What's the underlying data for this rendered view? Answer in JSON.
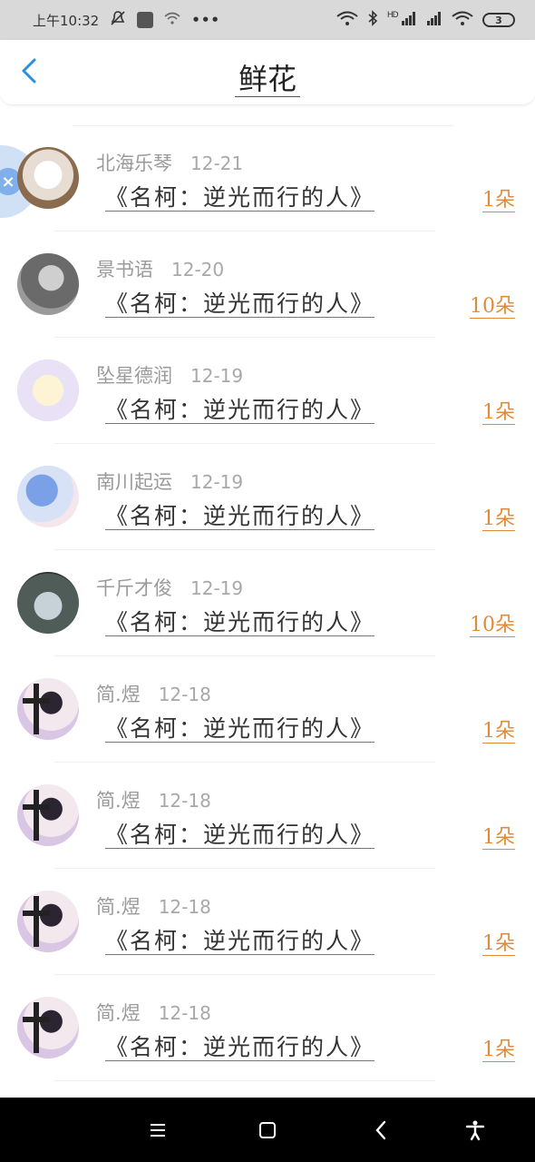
{
  "status_bar": {
    "time": "上午10:32",
    "battery": "3",
    "hd_label": "HD"
  },
  "header": {
    "title": "鲜花"
  },
  "gifts": [
    {
      "name": "北海乐琴",
      "date": "12-21",
      "gift": "《名柯：逆光而行的人》",
      "count": "1朵",
      "avatar": "cat-avatar"
    },
    {
      "name": "景书语",
      "date": "12-20",
      "gift": "《名柯：逆光而行的人》",
      "count": "10朵",
      "avatar": "bw-avatar"
    },
    {
      "name": "坠星德润",
      "date": "12-19",
      "gift": "《名柯：逆光而行的人》",
      "count": "1朵",
      "avatar": "anime-avatar"
    },
    {
      "name": "南川起运",
      "date": "12-19",
      "gift": "《名柯：逆光而行的人》",
      "count": "1朵",
      "avatar": "anime-avatar"
    },
    {
      "name": "千斤才俊",
      "date": "12-19",
      "gift": "《名柯：逆光而行的人》",
      "count": "10朵",
      "avatar": "forest-avatar"
    },
    {
      "name": "简.煜",
      "date": "12-18",
      "gift": "《名柯：逆光而行的人》",
      "count": "1朵",
      "avatar": "girl-avatar"
    },
    {
      "name": "简.煜",
      "date": "12-18",
      "gift": "《名柯：逆光而行的人》",
      "count": "1朵",
      "avatar": "girl-avatar"
    },
    {
      "name": "简.煜",
      "date": "12-18",
      "gift": "《名柯：逆光而行的人》",
      "count": "1朵",
      "avatar": "girl-avatar"
    },
    {
      "name": "简.煜",
      "date": "12-18",
      "gift": "《名柯：逆光而行的人》",
      "count": "1朵",
      "avatar": "girl-avatar"
    }
  ],
  "colors": {
    "accent": "#2b8fe0",
    "count": "#e08a3a",
    "name": "#9a9a9a"
  },
  "icons": {
    "back": "chevron-left-icon",
    "menu": "menu-icon",
    "home": "square-icon",
    "back_nav": "back-icon",
    "accessibility": "accessibility-icon"
  }
}
